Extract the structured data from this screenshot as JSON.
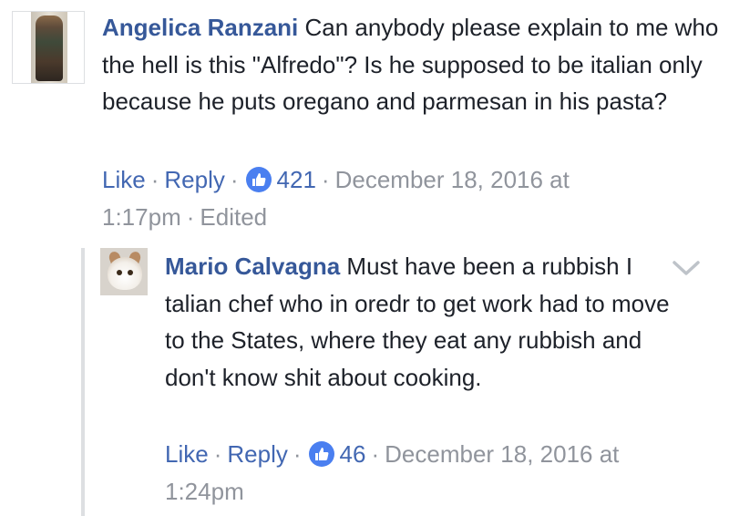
{
  "comments": [
    {
      "author": "Angelica Ranzani",
      "text": "Can anybody please explain to me who the hell is this \"Alfredo\"? Is he supposed to be italian only because he puts oregano and parmesan in his pasta?",
      "like_label": "Like",
      "reply_label": "Reply",
      "reaction_count": "421",
      "timestamp": "December 18, 2016 at 1:17pm",
      "edited_label": "Edited"
    }
  ],
  "reply": {
    "author": "Mario Calvagna",
    "text": "Must have been a rubbish I talian chef who in oredr to get work had to move to the States, where they eat any rubbish and don't know shit about cooking.",
    "like_label": "Like",
    "reply_label": "Reply",
    "reaction_count": "46",
    "timestamp": "December 18, 2016 at 1:24pm"
  },
  "icons": {
    "reaction": "thumbs-up-icon",
    "menu": "chevron-down-icon"
  },
  "colors": {
    "link": "#4267b2",
    "author": "#365899",
    "meta": "#90949c",
    "text": "#1d2129",
    "like_badge": "#4a7ff0"
  }
}
